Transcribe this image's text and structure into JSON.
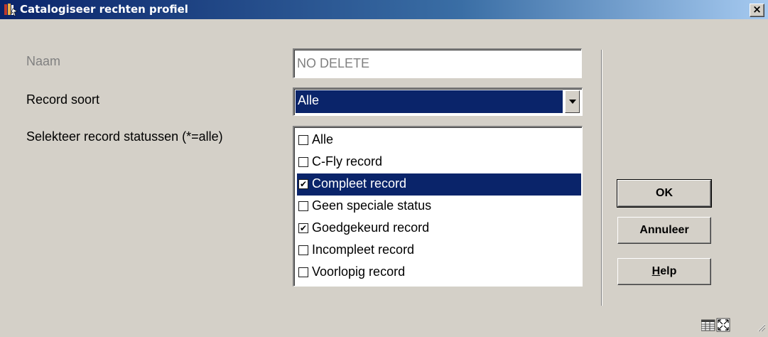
{
  "window": {
    "title": "Catalogiseer rechten profiel",
    "close_label": "×"
  },
  "form": {
    "naam": {
      "label": "Naam",
      "value": "NO DELETE"
    },
    "record_soort": {
      "label": "Record soort",
      "value": "Alle"
    },
    "statussen": {
      "label": "Selekteer record statussen (*=alle)",
      "items": [
        {
          "label": "Alle",
          "checked": false,
          "selected": false
        },
        {
          "label": "C-Fly record",
          "checked": false,
          "selected": false
        },
        {
          "label": "Compleet record",
          "checked": true,
          "selected": true
        },
        {
          "label": "Geen speciale status",
          "checked": false,
          "selected": false
        },
        {
          "label": "Goedgekeurd record",
          "checked": true,
          "selected": false
        },
        {
          "label": "Incompleet record",
          "checked": false,
          "selected": false
        },
        {
          "label": "Voorlopig record",
          "checked": false,
          "selected": false
        }
      ]
    }
  },
  "buttons": {
    "ok": "OK",
    "annuleer": "Annuleer",
    "help_mnemonic": "H",
    "help_rest": "elp"
  },
  "colors": {
    "title_gradient_start": "#0a246a",
    "title_gradient_end": "#a6caf0",
    "selection": "#0a246a",
    "face": "#d4d0c8"
  },
  "icons": {
    "title": "library-app-icon",
    "status": [
      "grid-view-icon",
      "maximize-icon",
      "resize-grip-icon"
    ]
  }
}
